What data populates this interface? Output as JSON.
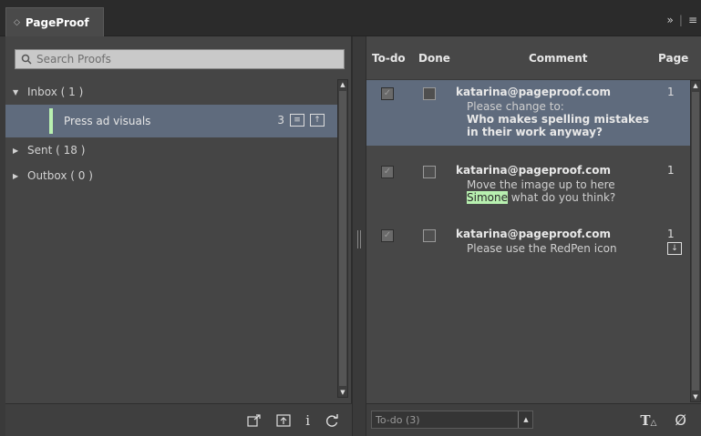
{
  "tab": {
    "title": "PageProof",
    "menu_chevrons": "»",
    "menu_icon": "≡"
  },
  "left": {
    "search": {
      "placeholder": "Search Proofs"
    },
    "tree": [
      {
        "label": "Inbox ( 1 )",
        "expanded": true
      },
      {
        "label": "Press ad visuals",
        "count": "3",
        "selected": true
      },
      {
        "label": "Sent ( 18 )",
        "expanded": false
      },
      {
        "label": "Outbox ( 0 )",
        "expanded": false
      }
    ],
    "footer_icons": [
      "export-icon",
      "upload-icon",
      "info-icon",
      "refresh-icon"
    ],
    "info_glyph": "i"
  },
  "right": {
    "headers": {
      "todo": "To-do",
      "done": "Done",
      "comment": "Comment",
      "page": "Page"
    },
    "comments": [
      {
        "author": "katarina@pageproof.com",
        "page": "1",
        "line1": "Please change to:",
        "line2": "Who makes spelling mistakes",
        "line3": "in their work anyway?",
        "selected": true
      },
      {
        "author": "katarina@pageproof.com",
        "page": "1",
        "line1": "Move the image up to here",
        "highlight": "Simone",
        "line2_rest": " what do you think?"
      },
      {
        "author": "katarina@pageproof.com",
        "page": "1",
        "line1": "Please use the RedPen icon"
      }
    ],
    "filter": {
      "value": "To-do (3)"
    },
    "footer_icons": [
      "text-tool-icon",
      "clear-icon"
    ],
    "clear_glyph": "Ø"
  },
  "colors": {
    "selection": "#5f6b7d",
    "highlight": "#b8f0b0",
    "panel": "#474747"
  }
}
